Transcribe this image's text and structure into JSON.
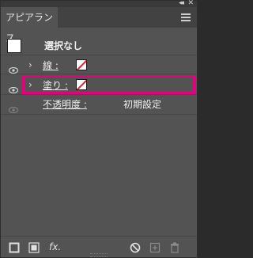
{
  "panel": {
    "tab_label": "アピアランス",
    "collapse_glyph": "◂◂",
    "close_glyph": "✕"
  },
  "selection": {
    "label": "選択なし"
  },
  "rows": [
    {
      "label": "線 :",
      "swatch": "none",
      "visible": true
    },
    {
      "label": "塗り :",
      "swatch": "none",
      "visible": true,
      "highlighted": true
    },
    {
      "label": "不透明度 :",
      "value": "初期設定",
      "visible": false
    }
  ],
  "bottom": {
    "fx_label": "fx."
  },
  "colors": {
    "highlight": "#e6007e",
    "none_slash": "#e2222a"
  }
}
